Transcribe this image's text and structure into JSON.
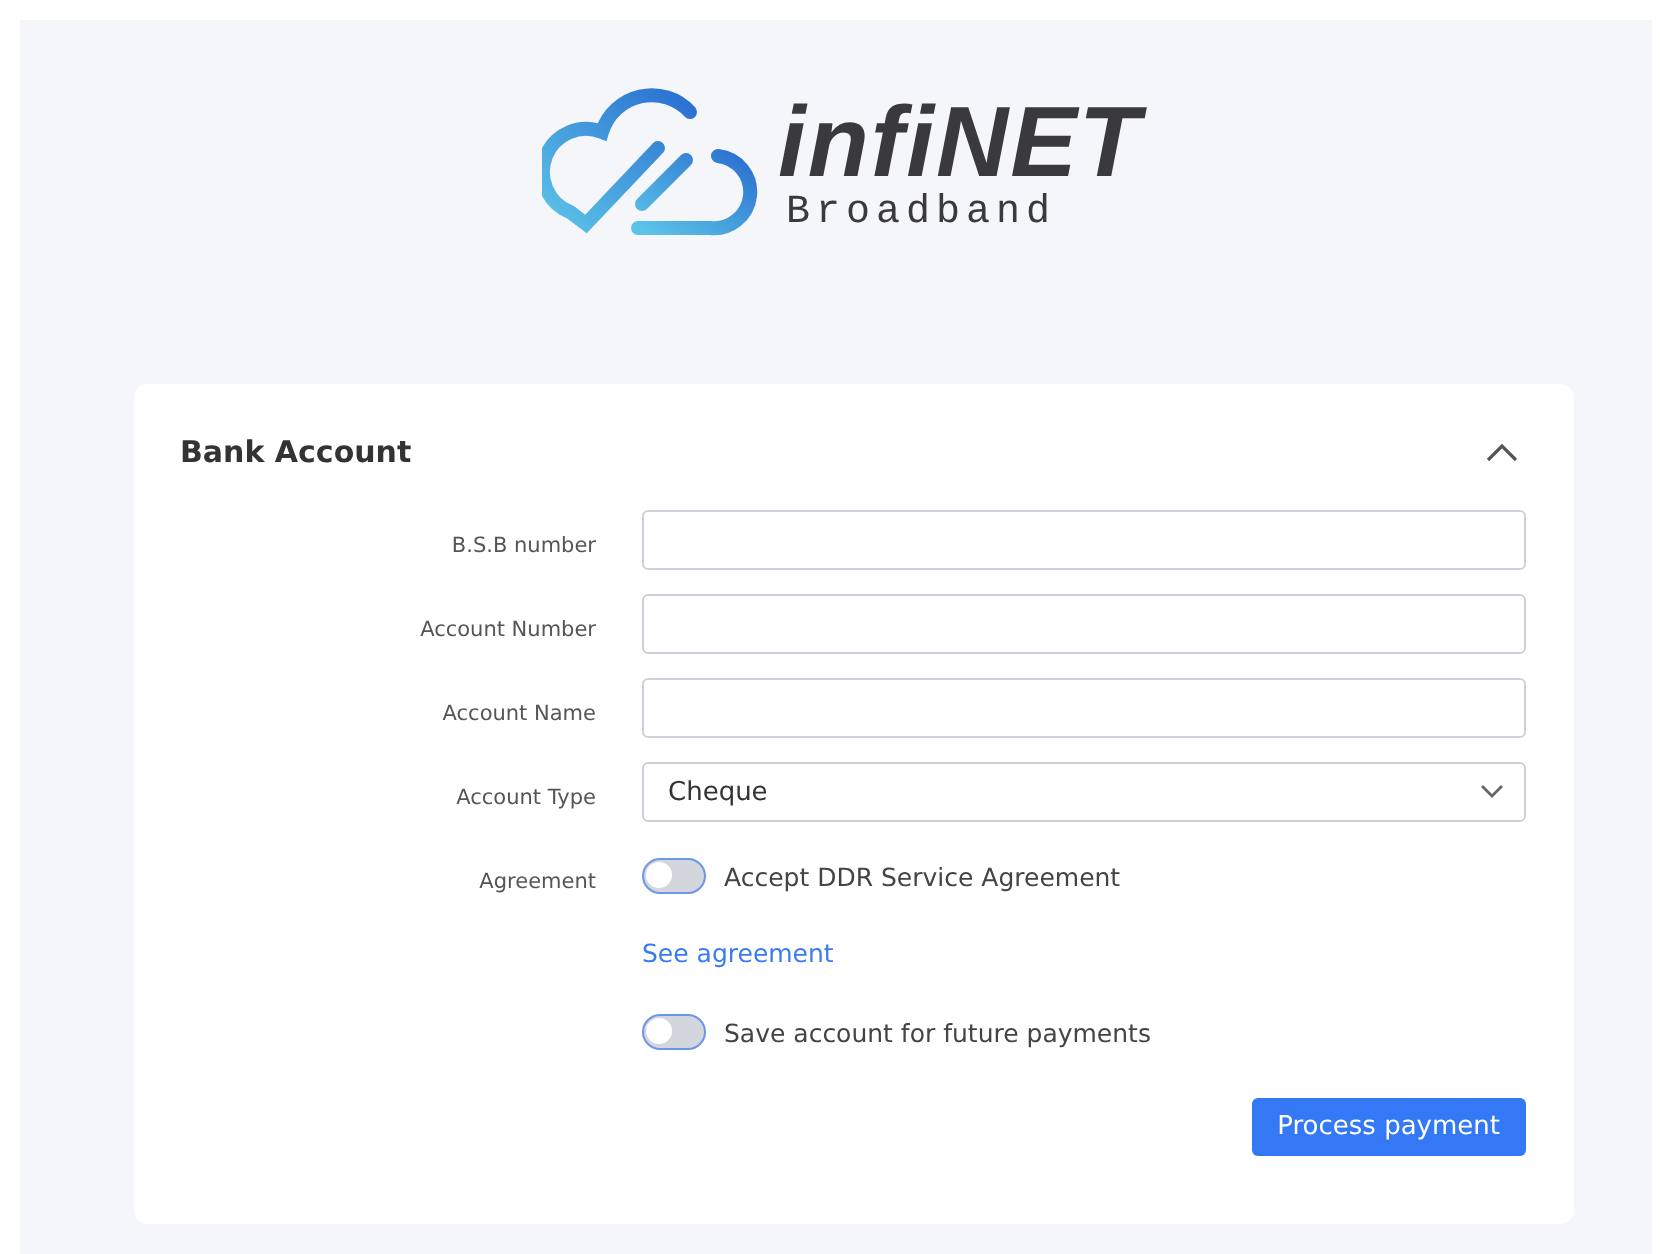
{
  "brand": {
    "name": "infiNET",
    "tagline": "Broadband"
  },
  "card": {
    "title": "Bank Account",
    "expanded": true,
    "fields": [
      {
        "kind": "text",
        "label": "B.S.B number"
      },
      {
        "kind": "text",
        "label": "Account Number"
      },
      {
        "kind": "text",
        "label": "Account Name"
      },
      {
        "kind": "select",
        "label": "Account Type",
        "value": "Cheque"
      },
      {
        "kind": "toggle",
        "label": "Agreement",
        "text": "Accept DDR Service Agreement",
        "on": false
      },
      {
        "kind": "link",
        "text": "See agreement"
      },
      {
        "kind": "toggle",
        "text": "Save account for future payments",
        "on": false
      }
    ],
    "submit": "Process payment"
  }
}
